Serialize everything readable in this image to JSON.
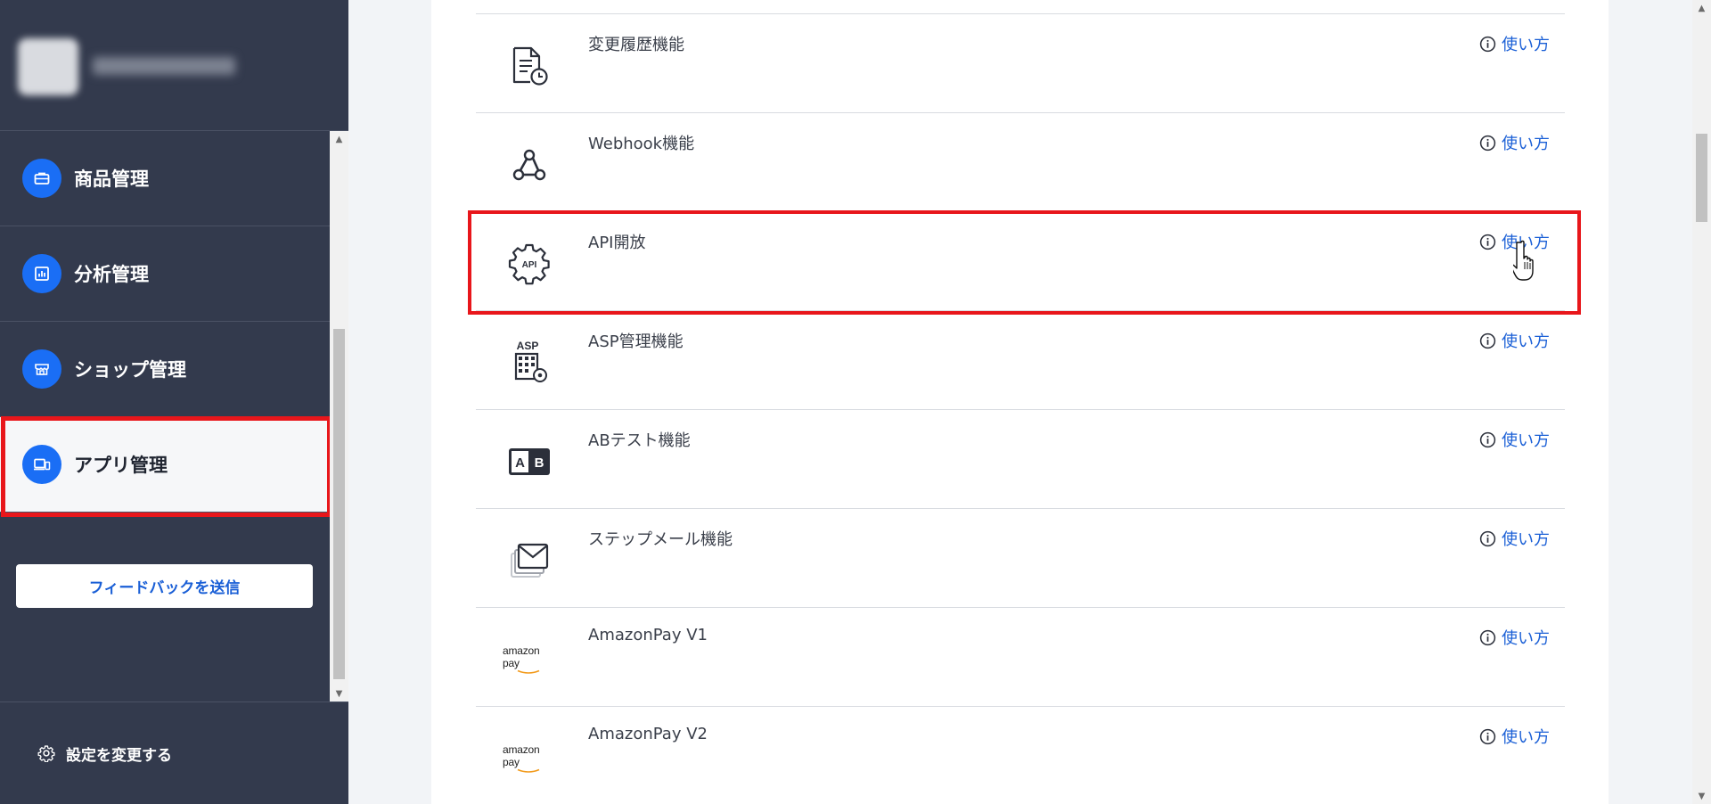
{
  "sidebar": {
    "nav_items": [
      {
        "label": "商品管理",
        "icon": "briefcase-icon"
      },
      {
        "label": "分析管理",
        "icon": "chart-icon"
      },
      {
        "label": "ショップ管理",
        "icon": "shop-icon"
      },
      {
        "label": "アプリ管理",
        "icon": "devices-icon",
        "active": true
      }
    ],
    "feedback_label": "フィードバックを送信",
    "settings_label": "設定を変更する"
  },
  "features": [
    {
      "name": "変更履歴機能",
      "icon": "document-history-icon",
      "howto": "使い方"
    },
    {
      "name": "Webhook機能",
      "icon": "webhook-icon",
      "howto": "使い方"
    },
    {
      "name": "API開放",
      "icon": "api-gear-icon",
      "howto": "使い方",
      "highlighted": true
    },
    {
      "name": "ASP管理機能",
      "icon": "asp-building-icon",
      "icon_text": "ASP",
      "howto": "使い方"
    },
    {
      "name": "ABテスト機能",
      "icon": "ab-test-icon",
      "icon_text_a": "A",
      "icon_text_b": "B",
      "howto": "使い方"
    },
    {
      "name": "ステップメール機能",
      "icon": "mail-stack-icon",
      "howto": "使い方"
    },
    {
      "name": "AmazonPay V1",
      "icon": "amazon-pay-logo",
      "icon_text": "amazon pay",
      "howto": "使い方"
    },
    {
      "name": "AmazonPay V2",
      "icon": "amazon-pay-logo",
      "icon_text": "amazon pay",
      "howto": "使い方"
    }
  ],
  "api_icon_text": "API",
  "colors": {
    "sidebar_bg": "#333a4d",
    "accent_blue": "#1a6ef5",
    "link_blue": "#1a5fd6",
    "highlight_red": "#e8161b"
  }
}
